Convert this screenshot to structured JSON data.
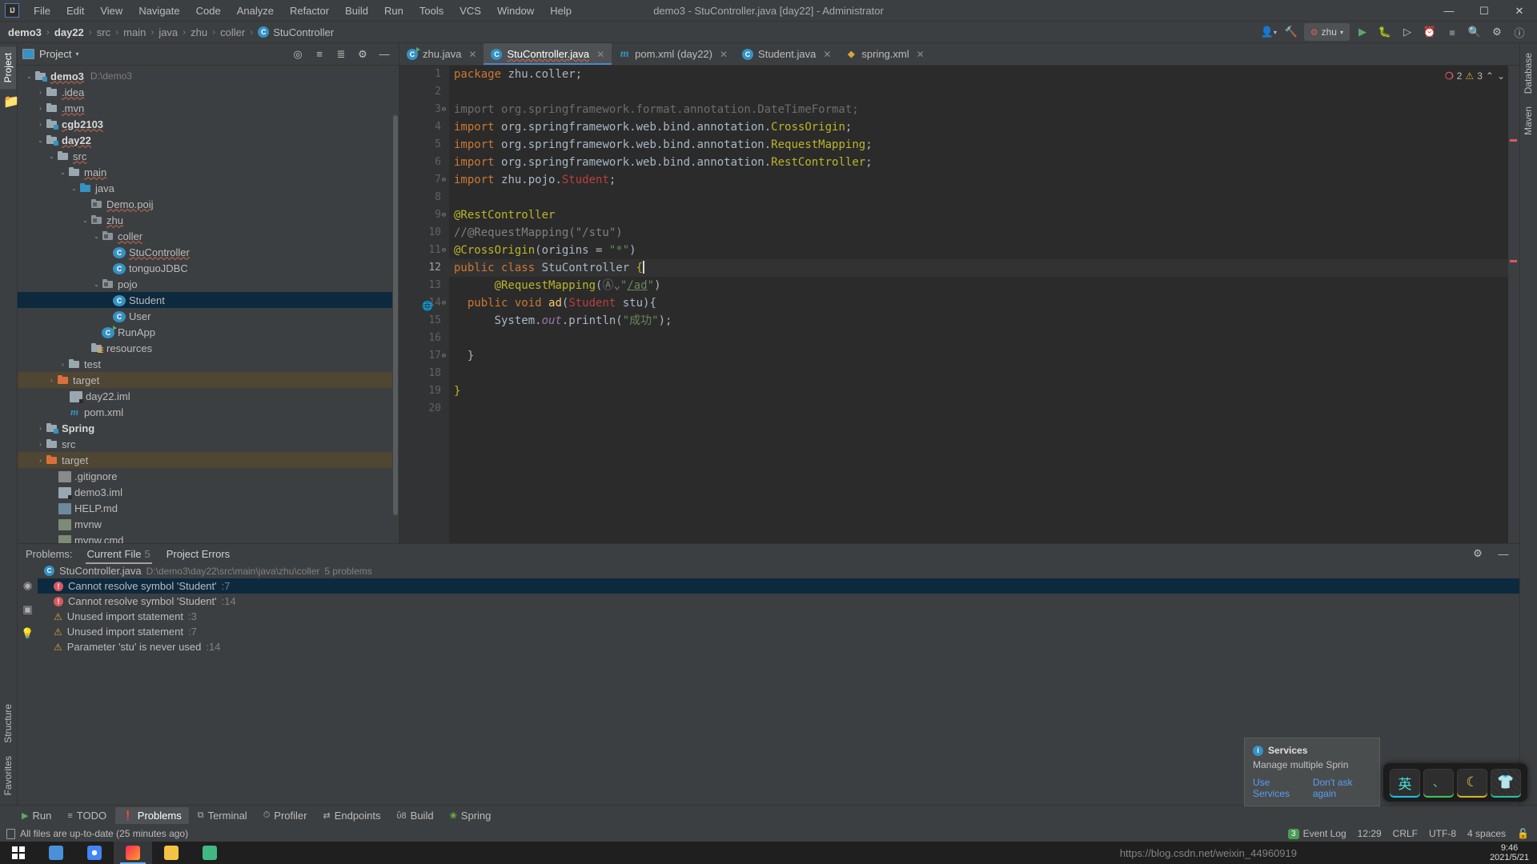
{
  "window": {
    "title": "demo3 - StuController.java [day22] - Administrator",
    "logo": "IJ",
    "minimize": "—",
    "maximize": "☐",
    "close": "✕"
  },
  "menubar": [
    {
      "label": "File"
    },
    {
      "label": "Edit"
    },
    {
      "label": "View"
    },
    {
      "label": "Navigate"
    },
    {
      "label": "Code"
    },
    {
      "label": "Analyze"
    },
    {
      "label": "Refactor"
    },
    {
      "label": "Build"
    },
    {
      "label": "Run"
    },
    {
      "label": "Tools"
    },
    {
      "label": "VCS"
    },
    {
      "label": "Window"
    },
    {
      "label": "Help"
    }
  ],
  "breadcrumb": {
    "items": [
      {
        "label": "demo3",
        "style": "bold"
      },
      {
        "label": "day22",
        "style": "bold"
      },
      {
        "label": "src",
        "style": "dim"
      },
      {
        "label": "main",
        "style": "dim"
      },
      {
        "label": "java",
        "style": "dim"
      },
      {
        "label": "zhu",
        "style": "dim"
      },
      {
        "label": "coller",
        "style": "dim"
      },
      {
        "label": "StuController",
        "style": "class",
        "icon": "C"
      }
    ],
    "separator": "›"
  },
  "navbar_right": {
    "run_config_label": "zhu",
    "run_config_icon": "rest-service-icon",
    "icons": [
      "user-icon",
      "hammer-icon",
      "run-icon",
      "debug-icon",
      "coverage-icon",
      "profile-icon",
      "stop-icon",
      "search-icon",
      "settings-icon",
      "help-icon"
    ]
  },
  "left_strip": {
    "top_tabs": [
      {
        "label": "Project",
        "active": true
      }
    ],
    "bottom_tabs": [
      {
        "label": "Structure"
      },
      {
        "label": "Favorites"
      }
    ]
  },
  "right_strip": {
    "tabs": [
      {
        "label": "Database"
      },
      {
        "label": "Maven"
      }
    ]
  },
  "project_panel": {
    "title": "Project",
    "caret": "▾",
    "toolbar_icons": [
      "locate-icon",
      "collapse-all-icon",
      "expand-icon",
      "settings-icon",
      "hide-icon"
    ],
    "tree": [
      {
        "indent": 0,
        "arrow": "⌄",
        "icon": "folder-mod",
        "label": "demo3",
        "bold": true,
        "path": "D:\\demo3",
        "squiggle": true
      },
      {
        "indent": 1,
        "arrow": "›",
        "icon": "folder",
        "label": ".idea",
        "squiggle": true
      },
      {
        "indent": 1,
        "arrow": "›",
        "icon": "folder",
        "label": ".mvn",
        "squiggle": true
      },
      {
        "indent": 1,
        "arrow": "›",
        "icon": "folder-mod",
        "label": "cgb2103",
        "bold": true,
        "squiggle": true
      },
      {
        "indent": 1,
        "arrow": "⌄",
        "icon": "folder-mod",
        "label": "day22",
        "bold": true,
        "squiggle": true
      },
      {
        "indent": 2,
        "arrow": "⌄",
        "icon": "folder",
        "label": "src",
        "squiggle": true
      },
      {
        "indent": 3,
        "arrow": "⌄",
        "icon": "folder",
        "label": "main",
        "squiggle": true
      },
      {
        "indent": 4,
        "arrow": "⌄",
        "icon": "folder-src",
        "label": "java"
      },
      {
        "indent": 5,
        "arrow": "",
        "icon": "folder-pkg",
        "label": "Demo.poij",
        "squiggle": true
      },
      {
        "indent": 5,
        "arrow": "⌄",
        "icon": "folder-pkg",
        "label": "zhu",
        "squiggle": true
      },
      {
        "indent": 6,
        "arrow": "⌄",
        "icon": "folder-pkg",
        "label": "coller",
        "squiggle": true
      },
      {
        "indent": 7,
        "arrow": "",
        "icon": "class",
        "label": "StuController",
        "squiggle": true
      },
      {
        "indent": 7,
        "arrow": "",
        "icon": "class",
        "label": "tonguoJDBC"
      },
      {
        "indent": 6,
        "arrow": "⌄",
        "icon": "folder-pkg",
        "label": "pojo"
      },
      {
        "indent": 7,
        "arrow": "",
        "icon": "class",
        "label": "Student",
        "selected": true
      },
      {
        "indent": 7,
        "arrow": "",
        "icon": "class",
        "label": "User"
      },
      {
        "indent": 6,
        "arrow": "",
        "icon": "class-run",
        "label": "RunApp"
      },
      {
        "indent": 5,
        "arrow": "",
        "icon": "folder-res",
        "label": "resources"
      },
      {
        "indent": 3,
        "arrow": "›",
        "icon": "folder",
        "label": "test"
      },
      {
        "indent": 2,
        "arrow": "›",
        "icon": "folder-target",
        "label": "target",
        "highlight": true
      },
      {
        "indent": 3,
        "arrow": "",
        "icon": "iml",
        "label": "day22.iml"
      },
      {
        "indent": 3,
        "arrow": "",
        "icon": "maven",
        "label": "pom.xml"
      },
      {
        "indent": 1,
        "arrow": "›",
        "icon": "folder-mod",
        "label": "Spring",
        "bold": true
      },
      {
        "indent": 1,
        "arrow": "›",
        "icon": "folder",
        "label": "src"
      },
      {
        "indent": 1,
        "arrow": "›",
        "icon": "folder-target",
        "label": "target",
        "highlight": true
      },
      {
        "indent": 2,
        "arrow": "",
        "icon": "gitignore",
        "label": ".gitignore"
      },
      {
        "indent": 2,
        "arrow": "",
        "icon": "iml",
        "label": "demo3.iml"
      },
      {
        "indent": 2,
        "arrow": "",
        "icon": "md",
        "label": "HELP.md"
      },
      {
        "indent": 2,
        "arrow": "",
        "icon": "sh",
        "label": "mvnw"
      },
      {
        "indent": 2,
        "arrow": "",
        "icon": "cmd",
        "label": "mvnw.cmd"
      }
    ]
  },
  "editor": {
    "tabs": [
      {
        "label": "zhu.java",
        "icon": "class-run",
        "active": false
      },
      {
        "label": "StuController.java",
        "icon": "class",
        "active": true
      },
      {
        "label": "pom.xml (day22)",
        "icon": "maven",
        "active": false
      },
      {
        "label": "Student.java",
        "icon": "class",
        "active": false
      },
      {
        "label": "spring.xml",
        "icon": "xml",
        "active": false
      }
    ],
    "tab_close": "✕",
    "inspection": {
      "error_count": "2",
      "warning_count": "3",
      "up": "⌃",
      "down": "⌄"
    },
    "lines": [
      {
        "n": "1",
        "tokens": [
          {
            "t": "package ",
            "c": "kw"
          },
          {
            "t": "zhu.coller;",
            "c": "plain"
          }
        ]
      },
      {
        "n": "2",
        "tokens": []
      },
      {
        "n": "3",
        "fold": "⊖",
        "tokens": [
          {
            "t": "import org.springframework.format.annotation.DateTimeFormat;",
            "c": "dim-imp"
          }
        ]
      },
      {
        "n": "4",
        "tokens": [
          {
            "t": "import ",
            "c": "kw"
          },
          {
            "t": "org.springframework.web.bind.annotation.",
            "c": "plain"
          },
          {
            "t": "CrossOrigin",
            "c": "ann"
          },
          {
            "t": ";",
            "c": "plain"
          }
        ]
      },
      {
        "n": "5",
        "tokens": [
          {
            "t": "import ",
            "c": "kw"
          },
          {
            "t": "org.springframework.web.bind.annotation.",
            "c": "plain"
          },
          {
            "t": "RequestMapping",
            "c": "ann"
          },
          {
            "t": ";",
            "c": "plain"
          }
        ]
      },
      {
        "n": "6",
        "tokens": [
          {
            "t": "import ",
            "c": "kw"
          },
          {
            "t": "org.springframework.web.bind.annotation.",
            "c": "plain"
          },
          {
            "t": "RestController",
            "c": "ann"
          },
          {
            "t": ";",
            "c": "plain"
          }
        ]
      },
      {
        "n": "7",
        "fold": "⊖",
        "tokens": [
          {
            "t": "import ",
            "c": "kw"
          },
          {
            "t": "zhu.pojo.",
            "c": "plain"
          },
          {
            "t": "Student",
            "c": "err"
          },
          {
            "t": ";",
            "c": "plain"
          }
        ]
      },
      {
        "n": "8",
        "tokens": []
      },
      {
        "n": "9",
        "fold": "⊖",
        "tokens": [
          {
            "t": "@RestController",
            "c": "ann"
          }
        ]
      },
      {
        "n": "10",
        "tokens": [
          {
            "t": "//@RequestMapping(\"/stu\")",
            "c": "cmt"
          }
        ]
      },
      {
        "n": "11",
        "fold": "⊖",
        "tokens": [
          {
            "t": "@CrossOrigin",
            "c": "ann"
          },
          {
            "t": "(origins = ",
            "c": "plain"
          },
          {
            "t": "\"*\"",
            "c": "str"
          },
          {
            "t": ")",
            "c": "plain"
          }
        ]
      },
      {
        "n": "12",
        "current": true,
        "tokens": [
          {
            "t": "public class ",
            "c": "kw"
          },
          {
            "t": "StuController ",
            "c": "plain"
          },
          {
            "t": "{",
            "c": "ann"
          }
        ],
        "caret": true
      },
      {
        "n": "13",
        "tokens": [
          {
            "t": "      @RequestMapping",
            "c": "ann"
          },
          {
            "t": "(",
            "c": "plain"
          },
          {
            "t": "Ⓐ⌄",
            "c": "cmt"
          },
          {
            "t": "\"",
            "c": "str"
          },
          {
            "t": "/ad",
            "c": "urlu"
          },
          {
            "t": "\"",
            "c": "str"
          },
          {
            "t": ")",
            "c": "plain"
          }
        ]
      },
      {
        "n": "14",
        "fold": "⊖",
        "gutter_icon": "web-icon",
        "tokens": [
          {
            "t": "  public void ",
            "c": "kw"
          },
          {
            "t": "ad",
            "c": "meth"
          },
          {
            "t": "(",
            "c": "plain"
          },
          {
            "t": "Student",
            "c": "err"
          },
          {
            "t": " stu){",
            "c": "plain"
          }
        ]
      },
      {
        "n": "15",
        "tokens": [
          {
            "t": "      System.",
            "c": "plain"
          },
          {
            "t": "out",
            "c": "fld"
          },
          {
            "t": ".println(",
            "c": "plain"
          },
          {
            "t": "\"成功\"",
            "c": "str"
          },
          {
            "t": ");",
            "c": "plain"
          }
        ]
      },
      {
        "n": "16",
        "tokens": []
      },
      {
        "n": "17",
        "fold": "⊖",
        "tokens": [
          {
            "t": "  }",
            "c": "plain"
          }
        ]
      },
      {
        "n": "18",
        "tokens": []
      },
      {
        "n": "19",
        "tokens": [
          {
            "t": "}",
            "c": "ann"
          }
        ]
      },
      {
        "n": "20",
        "tokens": []
      }
    ]
  },
  "problems": {
    "label": "Problems:",
    "tabs": [
      {
        "label": "Current File",
        "count": "5",
        "active": true
      },
      {
        "label": "Project Errors",
        "count": "",
        "active": false
      }
    ],
    "file_row": {
      "name": "StuController.java",
      "path": "D:\\demo3\\day22\\src\\main\\java\\zhu\\coller",
      "count": "5 problems",
      "icon": "C"
    },
    "items": [
      {
        "severity": "error",
        "text": "Cannot resolve symbol 'Student'",
        "line": ":7",
        "selected": true
      },
      {
        "severity": "error",
        "text": "Cannot resolve symbol 'Student'",
        "line": ":14"
      },
      {
        "severity": "warning",
        "text": "Unused import statement",
        "line": ":3"
      },
      {
        "severity": "warning",
        "text": "Unused import statement",
        "line": ":7"
      },
      {
        "severity": "warning",
        "text": "Parameter 'stu' is never used",
        "line": ":14"
      }
    ],
    "strip_icons": [
      "preview-icon",
      "layout-icon",
      "quickfix-icon"
    ],
    "right_icons": [
      "settings-icon",
      "hide-icon"
    ]
  },
  "notification": {
    "title": "Services",
    "body": "Manage multiple Sprin",
    "links": [
      {
        "label": "Use Services"
      },
      {
        "label": "Don't ask again"
      }
    ],
    "icon": "info-icon"
  },
  "ime_bar": {
    "keys": [
      {
        "glyph": "英",
        "name": "language-mode-key"
      },
      {
        "glyph": "、",
        "name": "punctuation-key"
      },
      {
        "glyph": "☽",
        "name": "moon-key"
      },
      {
        "glyph": "ὅ5",
        "name": "skin-key"
      }
    ]
  },
  "bottom_toolbar": {
    "tabs": [
      {
        "label": "Run",
        "icon": "run-icon",
        "active": false
      },
      {
        "label": "TODO",
        "icon": "todo-icon",
        "active": false
      },
      {
        "label": "Problems",
        "icon": "problems-icon",
        "active": true
      },
      {
        "label": "Terminal",
        "icon": "terminal-icon",
        "active": false
      },
      {
        "label": "Profiler",
        "icon": "profiler-icon",
        "active": false
      },
      {
        "label": "Endpoints",
        "icon": "endpoints-icon",
        "active": false
      },
      {
        "label": "Build",
        "icon": "build-icon",
        "active": false
      },
      {
        "label": "Spring",
        "icon": "spring-icon",
        "active": false
      }
    ]
  },
  "statusbar": {
    "message": "All files are up-to-date (25 minutes ago)",
    "event_log": "Event Log",
    "event_count": "3",
    "position": "12:29",
    "line_sep": "CRLF",
    "encoding": "UTF-8",
    "indent": "4 spaces",
    "lock": "ὑ3"
  },
  "taskbar": {
    "items": [
      {
        "name": "task-view-icon",
        "color": "#4a90d9"
      },
      {
        "name": "chrome-icon",
        "color": "#4285f4"
      },
      {
        "name": "intellij-icon",
        "color": "#fe2857",
        "active": true
      },
      {
        "name": "explorer-icon",
        "color": "#f5c344"
      },
      {
        "name": "hbuilder-icon",
        "color": "#41b883"
      }
    ],
    "clock_time": "9:46",
    "clock_date": "2021/5/21"
  },
  "watermark": "https://blog.csdn.net/weixin_44960919"
}
